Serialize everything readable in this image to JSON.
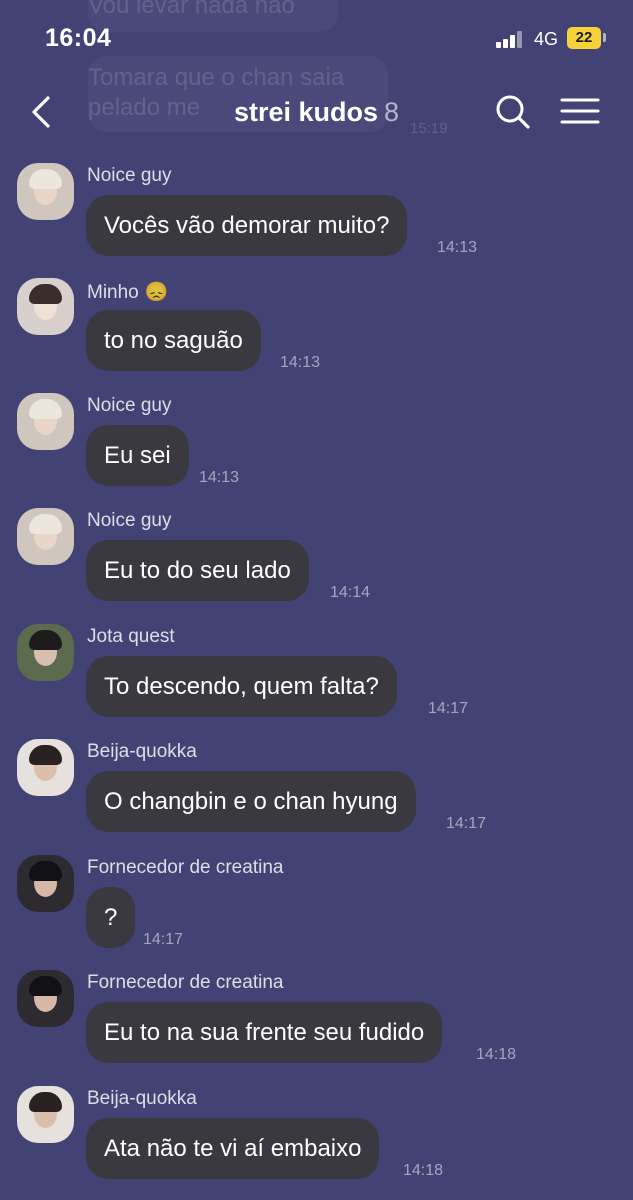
{
  "status_bar": {
    "time": "16:04",
    "network": "4G",
    "battery": "22"
  },
  "header": {
    "title": "strei kudos",
    "member_count": "8"
  },
  "ghost_messages": {
    "line1": "Vou levar nada não",
    "line2": "Tomara que o chan saia",
    "line3": "pelado me",
    "time": "15:19"
  },
  "messages": [
    {
      "sender": "Noice guy",
      "text": "Vocês vão demorar muito?",
      "time": "14:13",
      "avatar": "light-hair"
    },
    {
      "sender": "Minho",
      "sender_emoji": "😞",
      "text": "to no saguão",
      "time": "14:13",
      "avatar": "glasses"
    },
    {
      "sender": "Noice guy",
      "text": "Eu sei",
      "time": "14:13",
      "avatar": "light-hair"
    },
    {
      "sender": "Noice guy",
      "text": "Eu to do seu lado",
      "time": "14:14",
      "avatar": "light-hair"
    },
    {
      "sender": "Jota quest",
      "text": "To descendo, quem falta?",
      "time": "14:17",
      "avatar": "dark-hair"
    },
    {
      "sender": "Beija-quokka",
      "text": "O changbin e o chan hyung",
      "time": "14:17",
      "avatar": "dark-hair-light"
    },
    {
      "sender": "Fornecedor de creatina",
      "text": "?",
      "time": "14:17",
      "avatar": "black-outfit"
    },
    {
      "sender": "Fornecedor de creatina",
      "text": "Eu to na sua frente seu fudido",
      "time": "14:18",
      "avatar": "black-outfit"
    },
    {
      "sender": "Beija-quokka",
      "text": "Ata não te vi aí embaixo",
      "time": "14:18",
      "avatar": "dark-hair-light"
    }
  ],
  "colors": {
    "background": "#434275",
    "bubble": "#39393f",
    "battery": "#f6d23a"
  },
  "icons": [
    "back-chevron-icon",
    "search-icon",
    "hamburger-menu-icon",
    "signal-bars-icon",
    "battery-icon"
  ]
}
